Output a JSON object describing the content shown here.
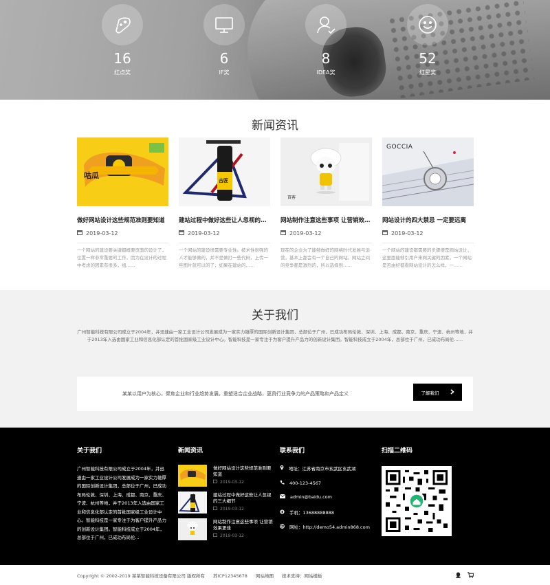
{
  "stats": [
    {
      "icon": "gamepad-icon",
      "value": "16",
      "label": "红点奖"
    },
    {
      "icon": "monitor-icon",
      "value": "6",
      "label": "IF奖"
    },
    {
      "icon": "user-check-icon",
      "value": "8",
      "label": "IDEA奖"
    },
    {
      "icon": "smiley-icon",
      "value": "52",
      "label": "红星奖"
    }
  ],
  "news": {
    "heading": "新闻资讯",
    "items": [
      {
        "thumb_text": "咕瓜",
        "title": "做好网站设计这些规范准则要知道",
        "date": "2019-03-12",
        "desc": "一个网站的建设要关键都概要页面的设计了，位置一样非常重要的工作，因为在设计的过程中考虑的因素有很多，组……"
      },
      {
        "thumb_text": "古匠",
        "title": "建站过程中做好这些让人忽视的三大细节",
        "date": "2019-03-12",
        "desc": "一个网站的建设很需要专业性。技术性很强的人才能够做的，并不是做打一些代码，上传一些图片就可以的了，如果在建站的……"
      },
      {
        "thumb_text": "百客",
        "title": "网站制作注意这些事项 让营销效果更佳",
        "date": "2019-03-12",
        "desc": "现在的企业为了能够做好的网络时代发展与运营，基本上都会有一个自己的网站。网站之间的竞争都是激烈的，所以选择到……"
      },
      {
        "thumb_text": "GOCCIA",
        "title": "网站设计的四大禁忌 一定要远离",
        "date": "2019-03-12",
        "desc": "一个网站的建设都需要的步骤便是网站设计，这里面能够引用户来网关键的因素，一个网站是否由好都看网站设计的怎么样，一……"
      }
    ]
  },
  "about": {
    "heading": "关于我们",
    "text": "广州智能科技有限公司成立于2004年，并迅速由一家工业设计公司发展成为一家实力雄厚的国际创新设计集团，总部位于广州，已成功布局伦敦、深圳、上海、成都、南京、重庆、宁波、杭州等地，并于2013年入选由国家工业和信息化部认定的首批国家级工业设计中心。智能科技是一家专注于为客户提升产品力的创新设计集团。智能科技成立于2004年，总部位于广州，已成功布局伦……",
    "cta_text": "某某以用户为核心，聚焦企业和行业趋势发展，重塑适合企业战略，更具行业竞争力的产品策略和产品定义",
    "cta_button": "了解我们"
  },
  "footer": {
    "about_title": "关于我们",
    "about_text": "广州智能科技有限公司成立于2004年，并迅速由一家工业设计公司发展成为一家实力雄厚的国际创新设计集团，总部位于广州，已成功布局伦敦、深圳、上海、成都、南京、重庆、宁波、杭州等地，并于2013年入选由国家工业和信息化部认定的首批国家级工业设计中心。智能科技是一家专注于为客户提升产品力的创新设计集团。智能科技成立于2004年，总部位于广州，已成功布局伦...",
    "news_title": "新闻资讯",
    "news": [
      {
        "title": "做好网站设计这些规范准则要知道",
        "date": "2019-03-12"
      },
      {
        "title": "建站过程中做好这些让人忽视的三大细节",
        "date": "2019-03-12"
      },
      {
        "title": "网站制作注意这些事项 让营销效果更佳",
        "date": "2019-03-12"
      }
    ],
    "contact_title": "联系我们",
    "contact": [
      {
        "icon": "location-icon",
        "text": "地址：江苏省南京市玄武区玄武湖"
      },
      {
        "icon": "phone-icon",
        "text": "400-123-4567"
      },
      {
        "icon": "mail-icon",
        "text": "admin@baidu.com"
      },
      {
        "icon": "mobile-icon",
        "text": "手机：13688888888"
      },
      {
        "icon": "globe-icon",
        "text": "网址：http://demo54.admin868.com"
      }
    ],
    "qr_title": "扫描二维码"
  },
  "bottom": {
    "copyright": "Copyright © 2002-2019 某某智能科技设备有限公司 版权所有",
    "icp": "苏ICP12345678",
    "sitemap": "网站地图",
    "support": "技术支持：网站模板"
  },
  "colors": {
    "accent_yellow": "#f5c800",
    "footer_bg": "#000000",
    "about_bg": "#f2f2f2"
  }
}
